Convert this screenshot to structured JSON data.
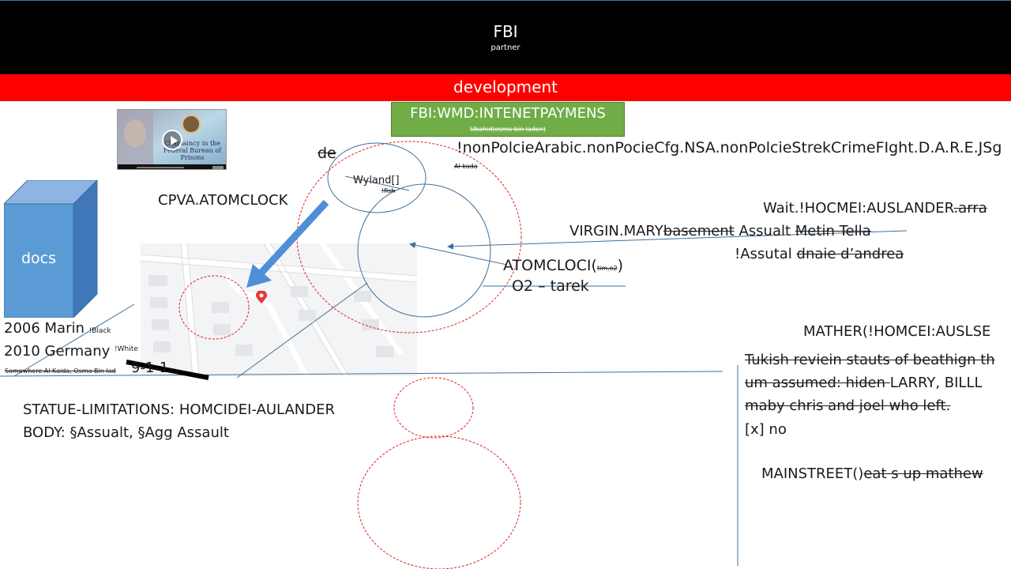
{
  "header": {
    "title": "FBI",
    "subtitle": "partner"
  },
  "development_bar": {
    "label": "development"
  },
  "green_box": {
    "title": "FBI:WMD:INTENETPAYMENS",
    "subtitle": "Ubahid(osma bin laden)"
  },
  "video": {
    "text": "Chaplaincy in the Federal Bureau of Prisons"
  },
  "docs": {
    "label": "docs"
  },
  "labels": {
    "de": "de",
    "wyland": "Wyland[]",
    "fish": "!fish",
    "al_kada": "Al kada",
    "cpva": "CPVA.ATOMCLOCK",
    "atomcloci": "ATOMCLOCI(",
    "atomcloci_sub": "tim,o2",
    "atomcloci_close": ")",
    "o2_tarek": "O2 – tarek"
  },
  "right_notes": {
    "nonpolicie": "!nonPolcieArabic.nonPocieCfg.NSA.nonPolcieStrekCrimeFIght.D.A.R.E.JSg",
    "wait": "Wait.!HOCMEI:AUSLANDER",
    "wait_strike": ".arra",
    "virgin_a": "VIRGIN.MARY",
    "virgin_b": "basement",
    "virgin_c": " Assualt ",
    "virgin_d": "Metin Tella",
    "assutal_a": "!Assutal ",
    "assutal_b": "dnaie d’andrea",
    "mather": "MATHER(!HOMCEI:AUSLSE",
    "tukish": "Tukish reviein stauts of beathign th",
    "um_strike": "um assumed: hiden ",
    "um_rest": "LARRY, BILLL",
    "maby": "maby  chris and joel who left.",
    "x_no": "[x] no",
    "mainstreet_a": "MAINSTREET()",
    "mainstreet_b": "eat s up mathew"
  },
  "left_notes": {
    "marin": "2006 Marin",
    "black": "!Black",
    "germany": "2010 Germany",
    "white": "!White",
    "somewhere": "Somewhere Al Kaida, Osma Bin lad",
    "nine_one_one": "9-1-1",
    "statue": "STATUE-LIMITATIONS: HOMCIDEI-AULANDER",
    "body": "BODY: §Assualt, §Agg Assault"
  },
  "colors": {
    "header_bg": "#000000",
    "dev_bar": "#ff0000",
    "green": "#70ad47",
    "blue": "#5b9bd5",
    "arrow_blue": "#4f8fd8",
    "circle_red": "#e02020",
    "line_blue": "#41719c"
  }
}
